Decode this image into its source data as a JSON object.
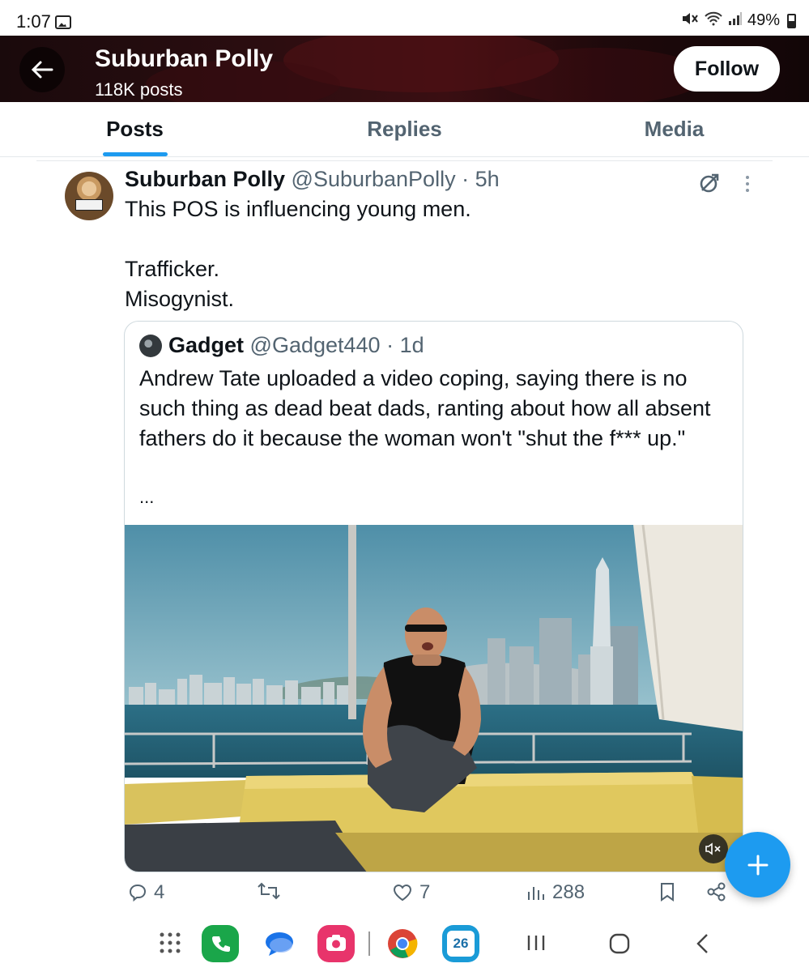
{
  "status_bar": {
    "time": "1:07",
    "battery": "49%"
  },
  "header": {
    "name": "Suburban Polly",
    "post_count": "118K posts",
    "follow_label": "Follow"
  },
  "tabs": [
    {
      "label": "Posts",
      "active": true
    },
    {
      "label": "Replies"
    },
    {
      "label": "Media"
    }
  ],
  "post": {
    "author": "Suburban Polly",
    "handle": "@SuburbanPolly",
    "time": "· 5h",
    "lines": [
      "This POS is influencing young men.",
      "",
      "Trafficker.",
      "Misogynist."
    ],
    "quote": {
      "author": "Gadget",
      "handle": "@Gadget440",
      "time": "· 1d",
      "text": "Andrew Tate uploaded a video coping, saying there is no such thing as dead beat dads, ranting about how all absent fathers do it because the woman won't \"shut the f*** up.\"",
      "ellipsis": "..."
    },
    "stats": {
      "replies": "4",
      "reposts": "",
      "likes": "7",
      "views": "288"
    }
  },
  "nav_apps": [
    {
      "name": "app-drawer-icon"
    },
    {
      "name": "phone-app-icon",
      "color": "#1aa64a"
    },
    {
      "name": "messages-app-icon",
      "color": "#1a73e8"
    },
    {
      "name": "screen-recorder-app-icon",
      "color": "#e8346b"
    },
    {
      "name": "chrome-app-icon"
    },
    {
      "name": "calendar-app-icon",
      "label": "26",
      "color": "#1a9bd7"
    }
  ],
  "colors": {
    "accent": "#1d9bf0",
    "text_primary": "#0f1419",
    "text_secondary": "#536471"
  }
}
